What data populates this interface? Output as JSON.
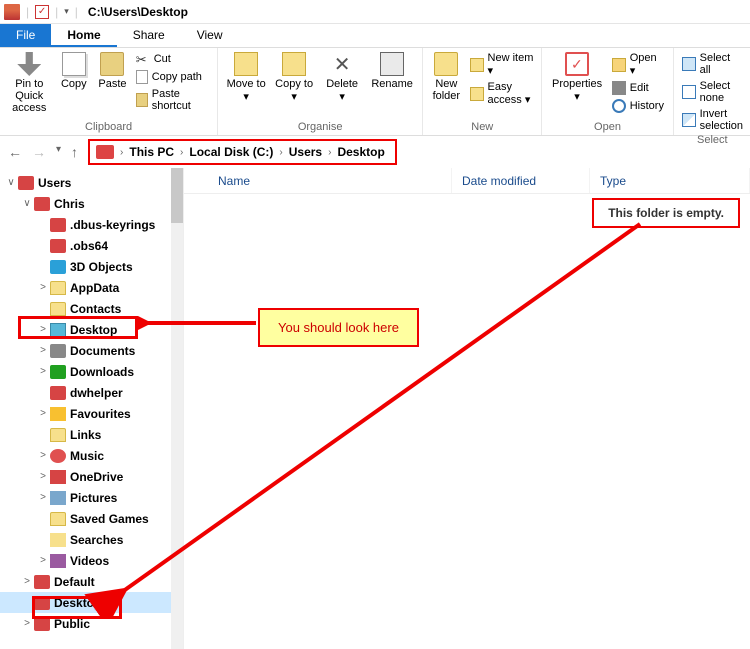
{
  "title_path": "C:\\Users\\Desktop",
  "tabs": {
    "file": "File",
    "home": "Home",
    "share": "Share",
    "view": "View"
  },
  "ribbon": {
    "clipboard": {
      "label": "Clipboard",
      "pin": "Pin to Quick access",
      "copy": "Copy",
      "paste": "Paste",
      "cut": "Cut",
      "copy_path": "Copy path",
      "paste_shortcut": "Paste shortcut"
    },
    "organise": {
      "label": "Organise",
      "move_to": "Move to",
      "copy_to": "Copy to",
      "delete": "Delete",
      "rename": "Rename"
    },
    "new": {
      "label": "New",
      "new_folder": "New folder",
      "new_item": "New item",
      "easy_access": "Easy access"
    },
    "open": {
      "label": "Open",
      "properties": "Properties",
      "open": "Open",
      "edit": "Edit",
      "history": "History"
    },
    "select": {
      "label": "Select",
      "select_all": "Select all",
      "select_none": "Select none",
      "invert": "Invert selection"
    }
  },
  "breadcrumbs": [
    "This PC",
    "Local Disk (C:)",
    "Users",
    "Desktop"
  ],
  "columns": {
    "name": "Name",
    "modified": "Date modified",
    "type": "Type"
  },
  "empty_message": "This folder is empty.",
  "annotation_callout": "You should look here",
  "tree": {
    "users": "Users",
    "chris": "Chris",
    "items_chris": [
      {
        "label": ".dbus-keyrings",
        "icon": "redf"
      },
      {
        "label": ".obs64",
        "icon": "redf"
      },
      {
        "label": "3D Objects",
        "icon": "bluef"
      },
      {
        "label": "AppData",
        "icon": "folder",
        "expandable": true
      },
      {
        "label": "Contacts",
        "icon": "folder"
      },
      {
        "label": "Desktop",
        "icon": "cyanbox",
        "expandable": true
      },
      {
        "label": "Documents",
        "icon": "grayf",
        "expandable": true
      },
      {
        "label": "Downloads",
        "icon": "down",
        "expandable": true
      },
      {
        "label": "dwhelper",
        "icon": "redf"
      },
      {
        "label": "Favourites",
        "icon": "star",
        "expandable": true
      },
      {
        "label": "Links",
        "icon": "folder"
      },
      {
        "label": "Music",
        "icon": "music",
        "expandable": true
      },
      {
        "label": "OneDrive",
        "icon": "onedrive",
        "expandable": true
      },
      {
        "label": "Pictures",
        "icon": "pic",
        "expandable": true
      },
      {
        "label": "Saved Games",
        "icon": "folder"
      },
      {
        "label": "Searches",
        "icon": "search"
      },
      {
        "label": "Videos",
        "icon": "video",
        "expandable": true
      }
    ],
    "default": "Default",
    "desktop_sel": "Desktop",
    "public": "Public"
  }
}
